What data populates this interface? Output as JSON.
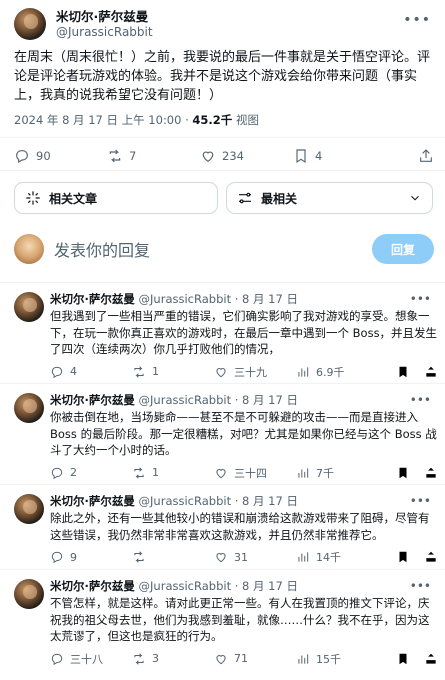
{
  "main": {
    "name": "米切尔·萨尔兹曼",
    "handle": "@JurassicRabbit",
    "text": "在周末（周末很忙！）之前，我要说的最后一件事就是关于悟空评论。评论是评论者玩游戏的体验。我并不是说这个游戏会给你带来问题（事实上，我真的说我希望它没有问题！）",
    "time": "2024 年 8 月 17 日 上午 10:00 · ",
    "views_count": "45.2千",
    "views_label": " 视图",
    "replies": "90",
    "reposts": "7",
    "likes": "234",
    "bookmarks": "4"
  },
  "related_posts_label": "相关文章",
  "sort_label": "最相关",
  "compose": {
    "placeholder": "发表你的回复",
    "button": "回复"
  },
  "replies": [
    {
      "name": "米切尔·萨尔兹曼",
      "handle": "@JurassicRabbit",
      "date": "8 月 17 日",
      "text": "但我遇到了一些相当严重的错误，它们确实影响了我对游戏的享受。想象一下，在玩一款你真正喜欢的游戏时，在最后一章中遇到一个 Boss，并且发生了四次（连续两次）你几乎打败他们的情况，",
      "replies": "4",
      "reposts": "1",
      "likes": "三十九",
      "views": "6.9千"
    },
    {
      "name": "米切尔·萨尔兹曼",
      "handle": "@JurassicRabbit",
      "date": "8 月 17 日",
      "text": "你被击倒在地，当场毙命——甚至不是不可躲避的攻击——而是直接进入 Boss 的最后阶段。那一定很糟糕，对吧？尤其是如果你已经与这个 Boss 战斗了大约一个小时的话。",
      "replies": "2",
      "reposts": "1",
      "likes": "三十四",
      "views": "7千"
    },
    {
      "name": "米切尔·萨尔兹曼",
      "handle": "@JurassicRabbit",
      "date": "8 月 17 日",
      "text": "除此之外，还有一些其他较小的错误和崩溃给这款游戏带来了阻碍，尽管有这些错误，我仍然非常非常喜欢这款游戏，并且仍然非常推荐它。",
      "replies": "9",
      "reposts": "",
      "likes": "31",
      "views": "14千"
    },
    {
      "name": "米切尔·萨尔兹曼",
      "handle": "@JurassicRabbit",
      "date": "8 月 17 日",
      "text": "不管怎样，就是这样。请对此更正常一些。有人在我置顶的推文下评论，庆祝我的祖父母去世，他们为我感到羞耻，就像……什么？我不在乎，因为这太荒谬了，但这也是疯狂的行为。",
      "replies": "三十八",
      "reposts": "3",
      "likes": "71",
      "views": "15千"
    }
  ]
}
